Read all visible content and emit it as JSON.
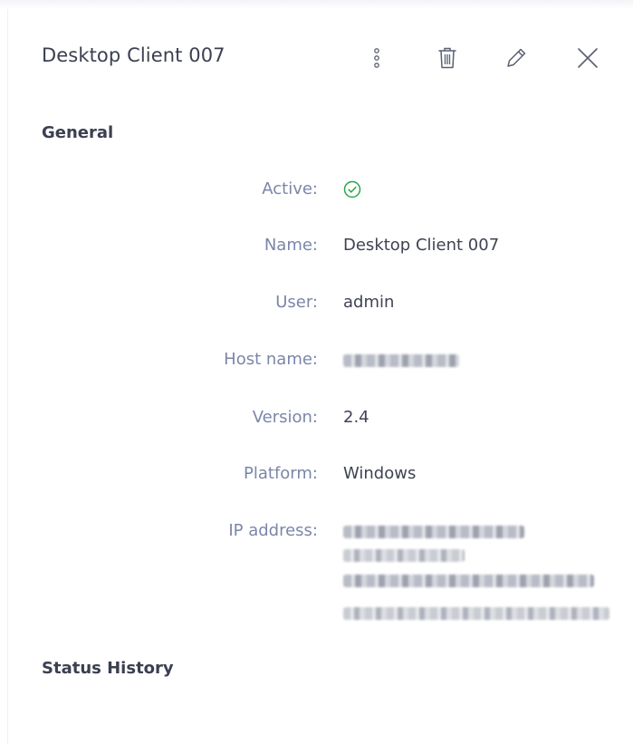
{
  "panel": {
    "title": "Desktop Client 007"
  },
  "header_actions": [
    {
      "name": "more-options",
      "icon": "kebab-vertical-icon"
    },
    {
      "name": "delete",
      "icon": "trash-icon"
    },
    {
      "name": "edit",
      "icon": "pencil-icon"
    },
    {
      "name": "close",
      "icon": "close-icon"
    }
  ],
  "sections": {
    "general": "General",
    "status_history": "Status History"
  },
  "fields": {
    "active": {
      "label": "Active:",
      "value": true,
      "icon": "check-circle-icon",
      "color": "#28a745"
    },
    "name": {
      "label": "Name:",
      "value": "Desktop Client 007"
    },
    "user": {
      "label": "User:",
      "value": "admin"
    },
    "host_name": {
      "label": "Host name:",
      "value_redacted": true
    },
    "version": {
      "label": "Version:",
      "value": "2.4"
    },
    "platform": {
      "label": "Platform:",
      "value": "Windows"
    },
    "ip_address": {
      "label": "IP address:",
      "value_redacted": true
    }
  },
  "colors": {
    "label": "#7b86a8",
    "value": "#3f4354",
    "title": "#3b3f50",
    "active_ok": "#28a745"
  }
}
